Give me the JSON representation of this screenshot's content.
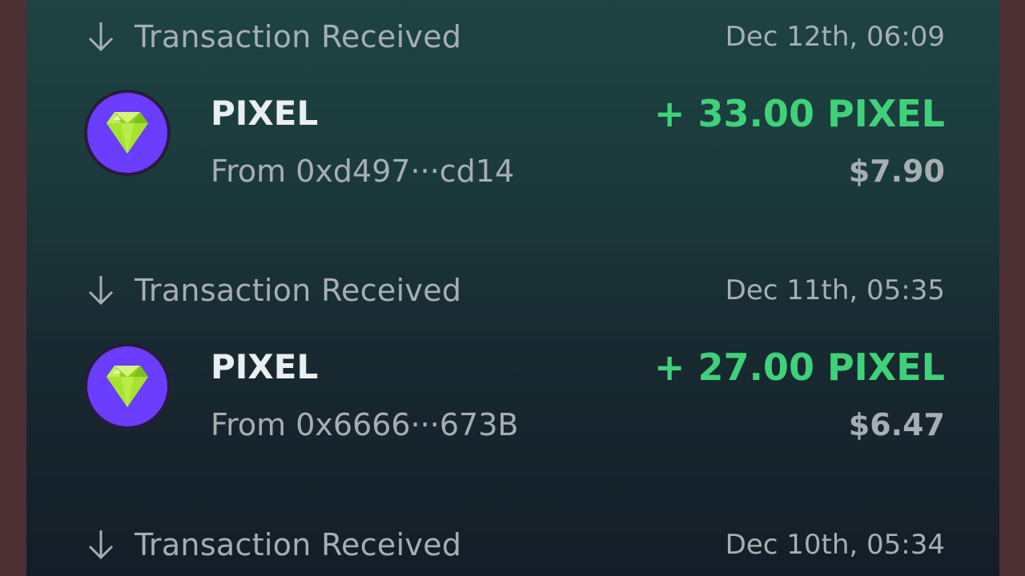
{
  "transactions": [
    {
      "type_label": "Transaction Received",
      "date": "Dec 12th, 06:09",
      "token": "PIXEL",
      "from": "From 0xd497···cd14",
      "amount": "+ 33.00 PIXEL",
      "usd": "$7.90",
      "direction_icon": "arrow-down-icon",
      "token_icon": "pixel-gem-icon"
    },
    {
      "type_label": "Transaction Received",
      "date": "Dec 11th, 05:35",
      "token": "PIXEL",
      "from": "From 0x6666···673B",
      "amount": "+ 27.00 PIXEL",
      "usd": "$6.47",
      "direction_icon": "arrow-down-icon",
      "token_icon": "pixel-gem-icon"
    },
    {
      "type_label": "Transaction Received",
      "date": "Dec 10th, 05:34",
      "direction_icon": "arrow-down-icon"
    }
  ],
  "colors": {
    "amount_positive": "#3fd17a",
    "muted_text": "#a7aeb3",
    "token_bg": "#6a3dff",
    "gem": "#a6e22e"
  }
}
